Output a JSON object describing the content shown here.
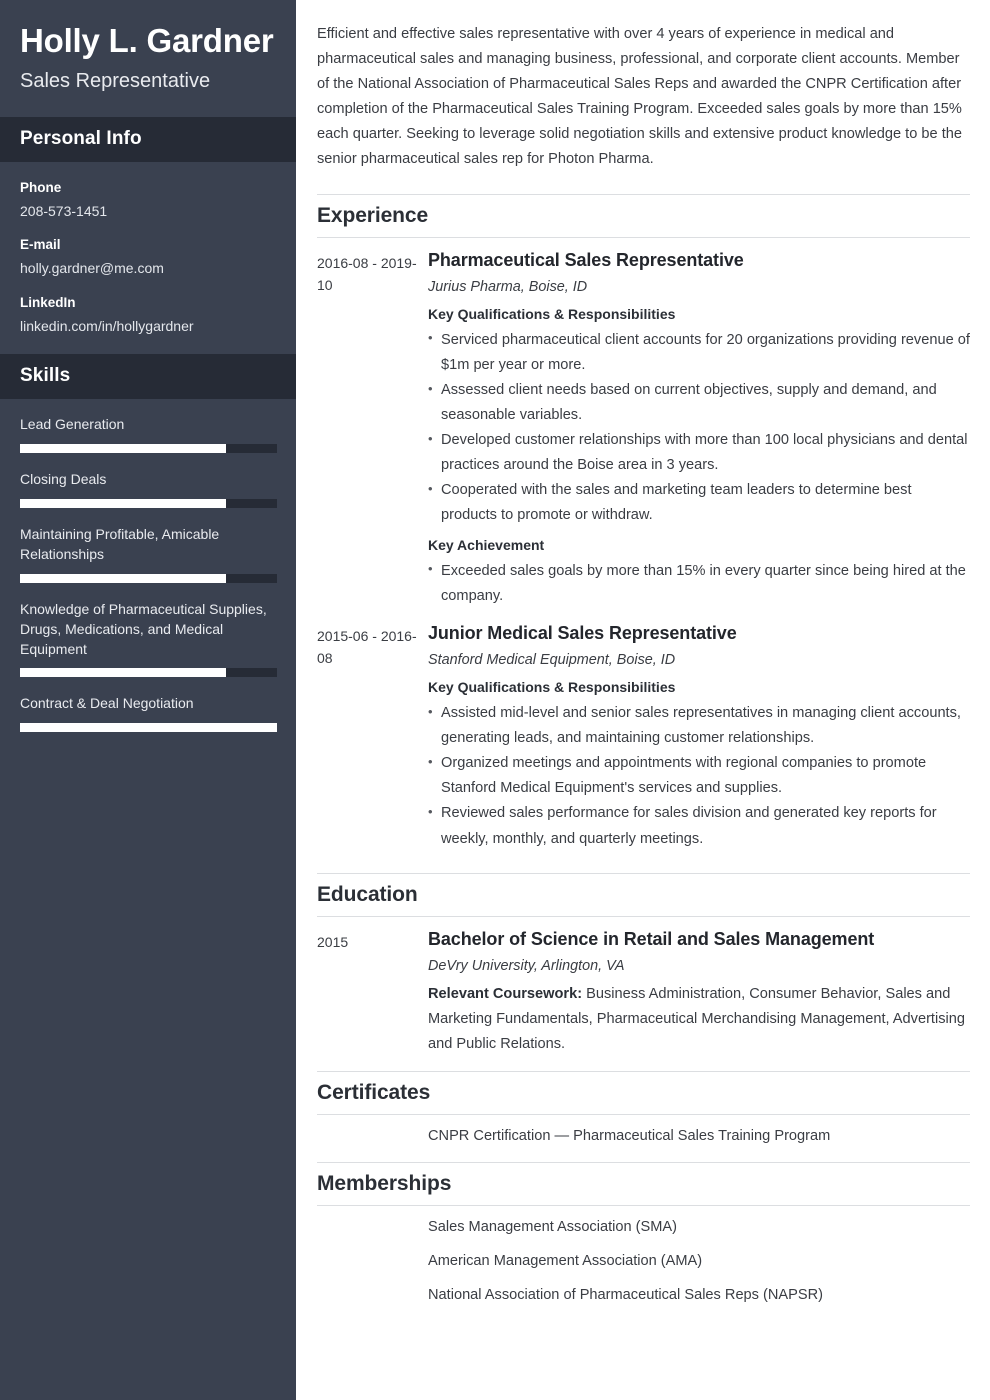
{
  "theme": {
    "sidebar_bg": "#3a4150",
    "sidebar_band_bg": "#262b36",
    "sidebar_text": "#ffffff",
    "skill_fill": "#ffffff",
    "rule_color": "#dcdee1",
    "body_text": "#3a3d43"
  },
  "sidebar": {
    "name": "Holly L. Gardner",
    "title": "Sales Representative",
    "personal_info": {
      "heading": "Personal Info",
      "items": [
        {
          "label": "Phone",
          "value": "208-573-1451"
        },
        {
          "label": "E-mail",
          "value": "holly.gardner@me.com"
        },
        {
          "label": "LinkedIn",
          "value": "linkedin.com/in/hollygardner"
        }
      ]
    },
    "skills": {
      "heading": "Skills",
      "items": [
        {
          "name": "Lead Generation",
          "level": 80
        },
        {
          "name": "Closing Deals",
          "level": 80
        },
        {
          "name": "Maintaining Profitable, Amicable Relationships",
          "level": 80
        },
        {
          "name": "Knowledge of Pharmaceutical Supplies, Drugs, Medications, and Medical Equipment",
          "level": 80
        },
        {
          "name": "Contract & Deal Negotiation",
          "level": 100
        }
      ]
    }
  },
  "main": {
    "summary": "Efficient and effective sales representative with over 4 years of experience in medical and pharmaceutical sales and managing business, professional, and corporate client accounts. Member of the National Association of Pharmaceutical Sales Reps and awarded the CNPR Certification after completion of the Pharmaceutical Sales Training Program. Exceeded sales goals by more than 15% each quarter. Seeking to leverage solid negotiation skills and extensive product knowledge to be the senior pharmaceutical sales rep for Photon Pharma.",
    "experience": {
      "heading": "Experience",
      "entries": [
        {
          "dates": "2016-08 - 2019-10",
          "role": "Pharmaceutical Sales Representative",
          "org": "Jurius Pharma, Boise, ID",
          "qualifications_label": "Key Qualifications & Responsibilities",
          "qualifications": [
            "Serviced pharmaceutical client accounts for 20 organizations providing revenue of $1m per year or more.",
            "Assessed client needs based on current objectives, supply and demand, and seasonable variables.",
            "Developed customer relationships with more than 100 local physicians and dental practices around the Boise area in 3 years.",
            "Cooperated with the sales and marketing team leaders to determine best products to promote or withdraw."
          ],
          "achievement_label": "Key Achievement",
          "achievements": [
            "Exceeded sales goals by more than 15% in every quarter since being hired at the company."
          ]
        },
        {
          "dates": "2015-06 - 2016-08",
          "role": "Junior Medical Sales Representative",
          "org": "Stanford Medical Equipment, Boise, ID",
          "qualifications_label": "Key Qualifications & Responsibilities",
          "qualifications": [
            "Assisted mid-level and senior sales representatives in managing client accounts, generating leads, and maintaining customer relationships.",
            "Organized meetings and appointments with regional companies to promote Stanford Medical Equipment's services and supplies.",
            "Reviewed sales performance for sales division and generated key reports for weekly, monthly, and quarterly meetings."
          ],
          "achievement_label": "",
          "achievements": []
        }
      ]
    },
    "education": {
      "heading": "Education",
      "entries": [
        {
          "dates": "2015",
          "degree": "Bachelor of Science in Retail and Sales Management",
          "school": "DeVry University, Arlington, VA",
          "coursework_label": "Relevant Coursework:",
          "coursework": "Business Administration, Consumer Behavior, Sales and Marketing Fundamentals, Pharmaceutical Merchandising Management, Advertising and Public Relations."
        }
      ]
    },
    "certificates": {
      "heading": "Certificates",
      "items": [
        "CNPR Certification — Pharmaceutical Sales Training Program"
      ]
    },
    "memberships": {
      "heading": "Memberships",
      "items": [
        "Sales Management Association (SMA)",
        "American Management Association (AMA)",
        "National Association of Pharmaceutical Sales Reps (NAPSR)"
      ]
    }
  }
}
